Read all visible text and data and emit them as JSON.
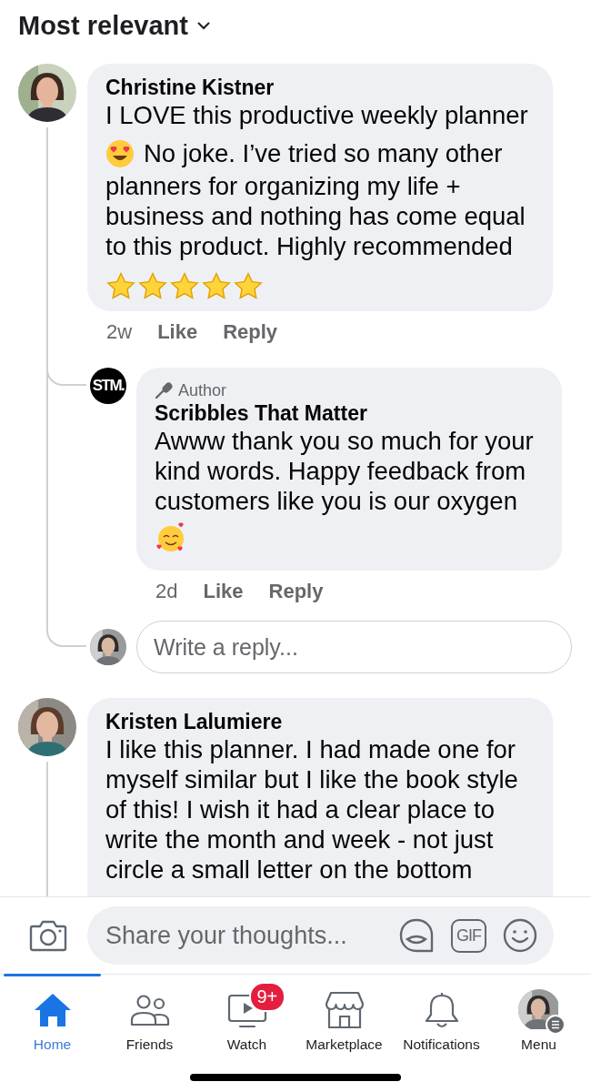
{
  "sort_menu": {
    "label": "Most relevant"
  },
  "comments": [
    {
      "author": "Christine Kistner",
      "avatar": {
        "kind": "picture"
      },
      "body": [
        {
          "kind": "text",
          "text": "I LOVE this productive weekly planner"
        },
        {
          "kind": "heart_eyes"
        },
        {
          "kind": "text",
          "text": "No joke. I’ve tried so many other"
        },
        {
          "kind": "text",
          "text": "planners for organizing my life + business and nothing has come equal to this product. Highly recommended"
        },
        {
          "kind": "stars",
          "stars": 5
        }
      ],
      "time": "2w",
      "actions": [
        "Like",
        "Reply"
      ],
      "replies": [
        {
          "author": "Scribbles That Matter",
          "badge": "Author",
          "avatar": {
            "kind": "logo",
            "text": "STM."
          },
          "body": [
            {
              "kind": "text",
              "text": "Awww thank you so much for your kind words. Happy feedback from customers like you is our oxygen"
            },
            {
              "kind": "smiling_hearts"
            }
          ],
          "time": "2d",
          "actions": [
            "Like",
            "Reply"
          ]
        }
      ],
      "reply_field": {
        "placeholder": "Write a reply..."
      }
    },
    {
      "author": "Kristen Lalumiere",
      "avatar": {
        "kind": "picture"
      },
      "body": [
        {
          "kind": "text",
          "text": "I like this planner. I had made one for myself similar but I like the book style of this! I wish it had a clear place to write the month and week - not just circle a small letter on the bottom"
        }
      ]
    }
  ],
  "composer": {
    "placeholder": "Share your thoughts...",
    "gif_label": "GIF"
  },
  "nav": [
    {
      "kind": "home",
      "label": "Home",
      "selected": true
    },
    {
      "kind": "friends",
      "label": "Friends",
      "selected": false
    },
    {
      "kind": "watch",
      "label": "Watch",
      "selected": false,
      "badge": "9+"
    },
    {
      "kind": "marketplace",
      "label": "Marketplace",
      "selected": false
    },
    {
      "kind": "notifications",
      "label": "Notifications",
      "selected": false
    },
    {
      "kind": "menu",
      "label": "Menu",
      "selected": false
    }
  ]
}
